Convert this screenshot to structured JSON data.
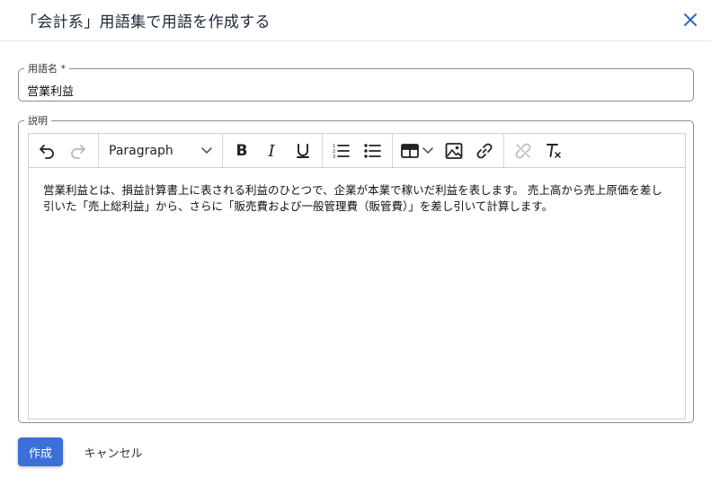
{
  "dialog": {
    "title": "「会計系」用語集で用語を作成する",
    "close_icon": "close-icon",
    "accent_color": "#3c6fd8"
  },
  "form": {
    "name_label": "用語名 *",
    "name_value": "営業利益",
    "description_label": "説明"
  },
  "toolbar": {
    "icons": [
      "undo-icon",
      "redo-icon",
      "bold-icon",
      "italic-icon",
      "underline-icon",
      "numbered-list-icon",
      "bulleted-list-icon",
      "table-icon",
      "image-icon",
      "link-icon",
      "unlink-icon",
      "clear-formatting-icon"
    ],
    "block_format": "Paragraph",
    "bold_glyph": "B",
    "italic_glyph": "I"
  },
  "editor": {
    "content": "営業利益とは、損益計算書上に表される利益のひとつで、企業が本業で稼いだ利益を表します。 売上高から売上原価を差し引いた「売上総利益」から、さらに「販売費および一般管理費（販管費）」を差し引いて計算します。"
  },
  "actions": {
    "create_label": "作成",
    "cancel_label": "キャンセル"
  }
}
